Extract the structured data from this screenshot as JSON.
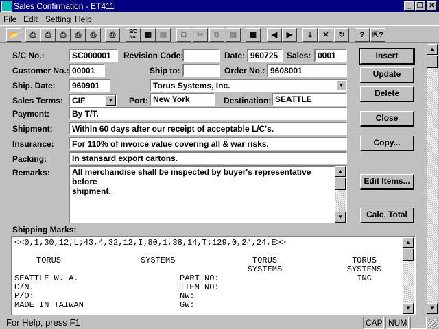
{
  "window": {
    "title": "Sales Confirmation - ET411",
    "controls": {
      "minimize": "_",
      "restore": "❐",
      "close": "✕"
    }
  },
  "menu": [
    "File",
    "Edit",
    "Setting",
    "Help"
  ],
  "toolbar": {
    "sc_no_button": "S/C No.",
    "disabled_icons": [
      "cut-icon",
      "copy-icon",
      "paste-icon"
    ]
  },
  "form": {
    "sc_no": {
      "label": "S/C No.:",
      "value": "SC000001"
    },
    "revision_code": {
      "label": "Revision Code:",
      "value": ""
    },
    "date": {
      "label": "Date:",
      "value": "960725"
    },
    "sales": {
      "label": "Sales:",
      "value": "0001"
    },
    "customer_no": {
      "label": "Customer No.:",
      "value": "00001"
    },
    "ship_to": {
      "label": "Ship to:",
      "value": ""
    },
    "order_no": {
      "label": "Order No.:",
      "value": "9608001"
    },
    "ship_date": {
      "label": "Ship. Date:",
      "value": "960901"
    },
    "customer_name": {
      "value": "Torus Systems, Inc."
    },
    "sales_terms": {
      "label": "Sales Terms:",
      "value": "CIF"
    },
    "port": {
      "label": "Port:",
      "value": "New York"
    },
    "destination": {
      "label": "Destination:",
      "value": "SEATTLE"
    },
    "payment": {
      "label": "Payment:",
      "value": "By T/T."
    },
    "shipment": {
      "label": "Shipment:",
      "value": "Within 60 days after our receipt of acceptable L/C's."
    },
    "insurance": {
      "label": "Insurance:",
      "value": "For 110% of invoice value covering all & war risks."
    },
    "packing": {
      "label": "Packing:",
      "value": "In stansard export cartons."
    },
    "remarks": {
      "label": "Remarks:",
      "line1": "All merchandise shall be inspected by buyer's representative before",
      "line2": "shipment."
    },
    "shipping_marks": {
      "label": "Shipping Marks:",
      "line1": "<<0,1,30,12,L;43,4,32,12,I;80,1,38,14,T;129,0,24,24,E>>",
      "col1": [
        "TORUS",
        "",
        "SEATTLE W. A.",
        "C/N.",
        "P/O:",
        "MADE IN TAIWAN"
      ],
      "col2": [
        "SYSTEMS",
        "",
        "PART NO:",
        "ITEM NO:",
        "NW:",
        "GW:"
      ],
      "col3": [
        "TORUS",
        "SYSTEMS"
      ],
      "col4": [
        "TORUS",
        "SYSTEMS",
        "INC"
      ]
    }
  },
  "buttons": {
    "insert": "Insert",
    "update": "Update",
    "delete": "Delete",
    "close": "Close",
    "copy": "Copy...",
    "edit_items": "Edit Items...",
    "calc_total": "Calc. Total"
  },
  "status": {
    "help": "For Help, press F1",
    "cap": "CAP",
    "num": "NUM"
  }
}
